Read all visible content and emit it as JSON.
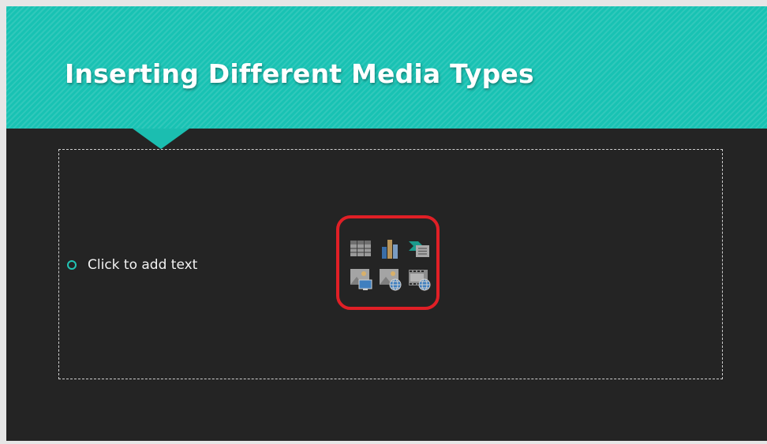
{
  "slide": {
    "title": "Inserting Different Media Types",
    "content_placeholder": {
      "bullet_text": "Click to add text"
    }
  },
  "insert_icons": [
    {
      "name": "insert-table-icon",
      "tooltip": ""
    },
    {
      "name": "insert-chart-icon",
      "tooltip": ""
    },
    {
      "name": "insert-smartart-icon",
      "tooltip": ""
    },
    {
      "name": "insert-picture-icon",
      "tooltip": ""
    },
    {
      "name": "insert-online-picture-icon",
      "tooltip": ""
    },
    {
      "name": "insert-video-icon",
      "tooltip": ""
    }
  ],
  "colors": {
    "banner": "#18c2b3",
    "slide_background": "#242424",
    "bullet": "#21c4b4",
    "highlight": "#e01f26"
  }
}
